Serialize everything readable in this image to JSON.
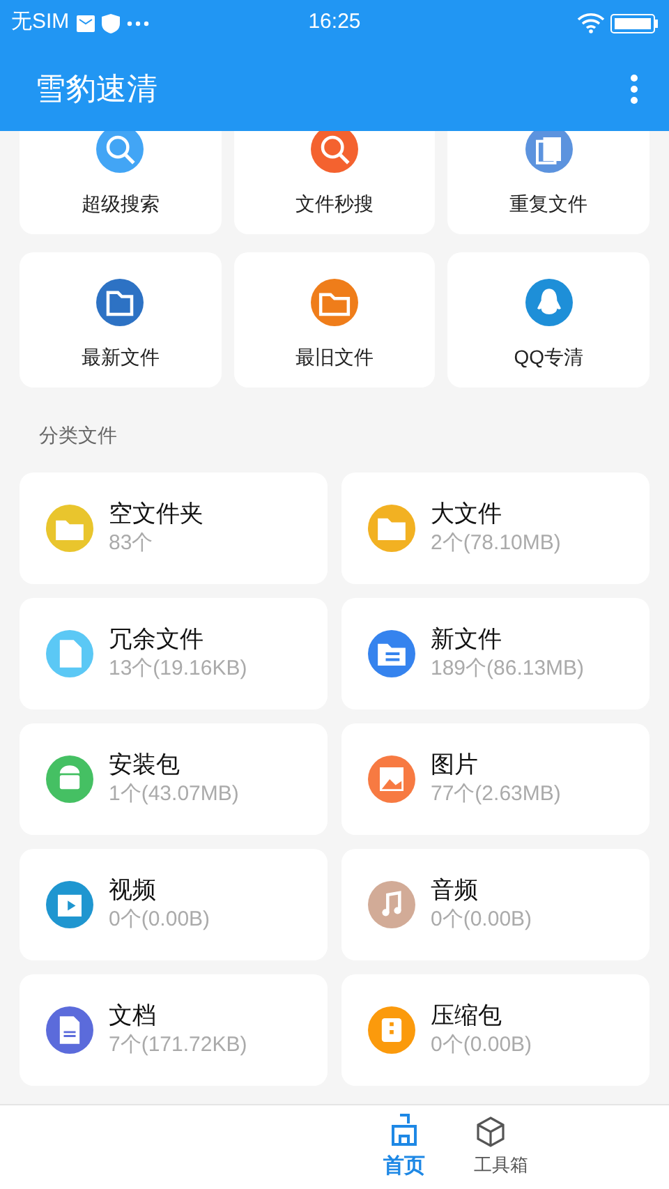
{
  "status_bar": {
    "carrier": "无SIM",
    "time": "16:25"
  },
  "app_bar": {
    "title": "雪豹速清"
  },
  "tools": [
    {
      "label": "超级搜索",
      "color": "#42a5f5"
    },
    {
      "label": "文件秒搜",
      "color": "#f4622f"
    },
    {
      "label": "重复文件",
      "color": "#5c93de"
    },
    {
      "label": "最新文件",
      "color": "#2d72c4"
    },
    {
      "label": "最旧文件",
      "color": "#ef7d1a"
    },
    {
      "label": "QQ专清",
      "color": "#1e8fd8"
    }
  ],
  "section_title": "分类文件",
  "categories": [
    {
      "name": "空文件夹",
      "detail": "83个",
      "color": "#e9c52d"
    },
    {
      "name": "大文件",
      "detail": "2个(78.10MB)",
      "color": "#f2b122"
    },
    {
      "name": "冗余文件",
      "detail": "13个(19.16KB)",
      "color": "#5bc8f5"
    },
    {
      "name": "新文件",
      "detail": "189个(86.13MB)",
      "color": "#3583ee"
    },
    {
      "name": "安装包",
      "detail": "1个(43.07MB)",
      "color": "#45c063"
    },
    {
      "name": "图片",
      "detail": "77个(2.63MB)",
      "color": "#f77a42"
    },
    {
      "name": "视频",
      "detail": "0个(0.00B)",
      "color": "#1f96d0"
    },
    {
      "name": "音频",
      "detail": "0个(0.00B)",
      "color": "#d2ab97"
    },
    {
      "name": "文档",
      "detail": "7个(171.72KB)",
      "color": "#5b6bdb"
    },
    {
      "name": "压缩包",
      "detail": "0个(0.00B)",
      "color": "#fb9a0c"
    }
  ],
  "bottom_nav": [
    {
      "label": "首页",
      "selected": true
    },
    {
      "label": "工具箱",
      "selected": false
    }
  ]
}
